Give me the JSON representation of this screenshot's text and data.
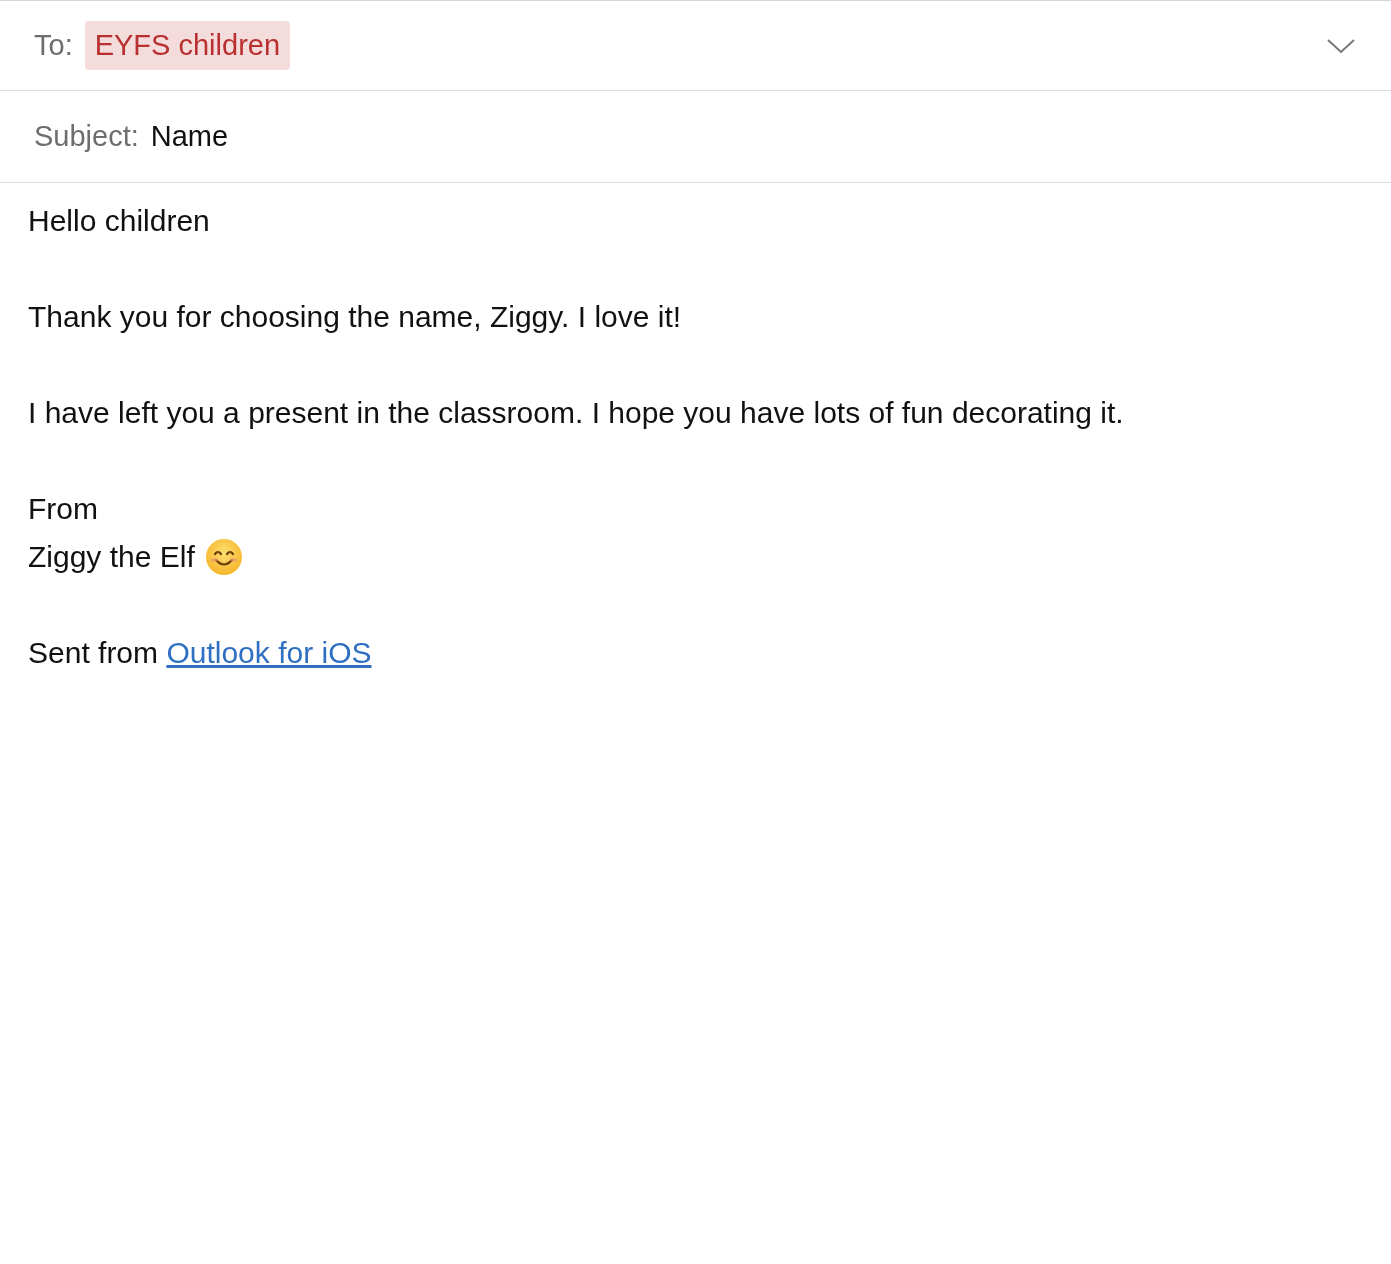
{
  "to": {
    "label": "To:",
    "recipients": [
      {
        "name": "EYFS children",
        "selected": true
      }
    ]
  },
  "subject": {
    "label": "Subject:",
    "value": "Name"
  },
  "body": {
    "paragraphs": [
      "Hello children",
      "Thank you for choosing the name, Ziggy. I love it!",
      "I have left you a present in the classroom. I hope you have lots of fun decorating it."
    ],
    "signature": {
      "closing": "From",
      "name": "Ziggy the Elf",
      "smiley": true
    },
    "footer": {
      "prefix": "Sent from",
      "link": "Outlook for iOS"
    }
  }
}
